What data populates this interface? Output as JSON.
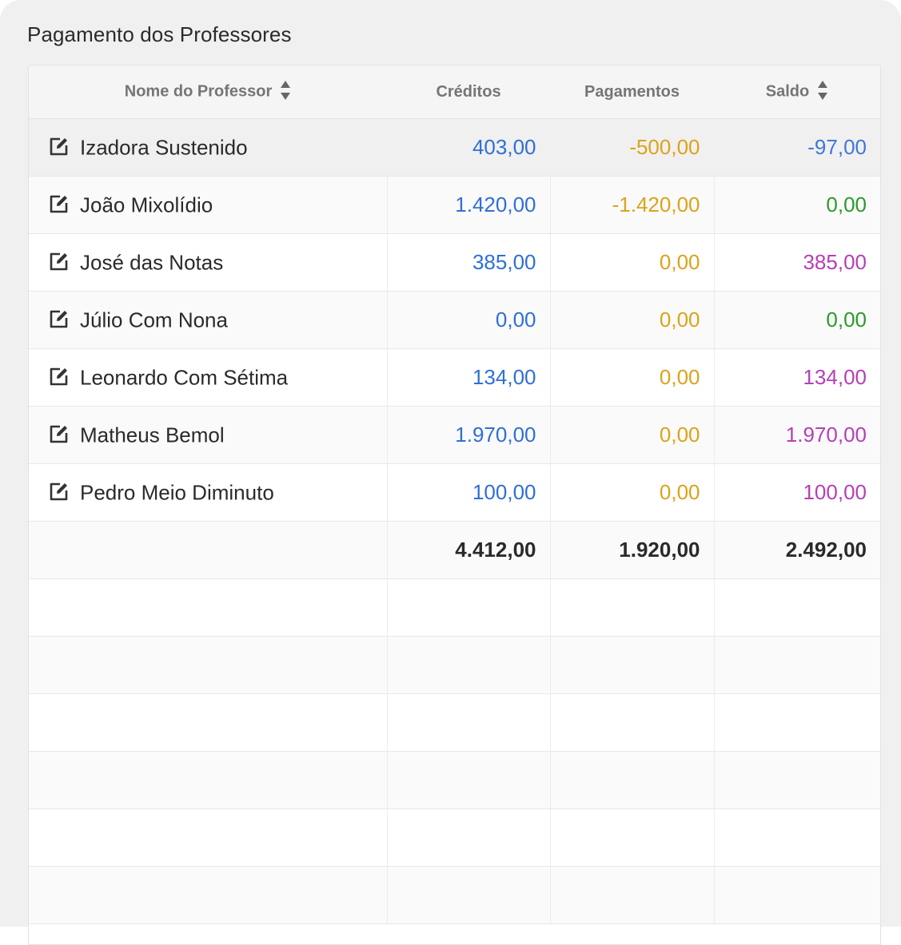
{
  "panel": {
    "title": "Pagamento dos Professores"
  },
  "table": {
    "headers": {
      "name": "Nome do Professor",
      "credits": "Créditos",
      "payments": "Pagamentos",
      "balance": "Saldo"
    },
    "rows": [
      {
        "name": "Izadora Sustenido",
        "credits": "403,00",
        "payments": "-500,00",
        "balance": "-97,00"
      },
      {
        "name": "João Mixolídio",
        "credits": "1.420,00",
        "payments": "-1.420,00",
        "balance": "0,00"
      },
      {
        "name": "José das Notas",
        "credits": "385,00",
        "payments": "0,00",
        "balance": "385,00"
      },
      {
        "name": "Júlio Com Nona",
        "credits": "0,00",
        "payments": "0,00",
        "balance": "0,00"
      },
      {
        "name": "Leonardo Com Sétima",
        "credits": "134,00",
        "payments": "0,00",
        "balance": "134,00"
      },
      {
        "name": "Matheus Bemol",
        "credits": "1.970,00",
        "payments": "0,00",
        "balance": "1.970,00"
      },
      {
        "name": "Pedro Meio Diminuto",
        "credits": "100,00",
        "payments": "0,00",
        "balance": "100,00"
      }
    ],
    "totals": {
      "credits": "4.412,00",
      "payments": "1.920,00",
      "balance": "2.492,00"
    }
  },
  "colors": {
    "credits": "#2f6fd6",
    "payments": "#dba319",
    "balance_negative": "#3f78d6",
    "balance_zero": "#2b9a2b",
    "balance_positive": "#b53fb8"
  },
  "icons": {
    "row_action": "edit-icon",
    "sort": "sort-icon"
  }
}
